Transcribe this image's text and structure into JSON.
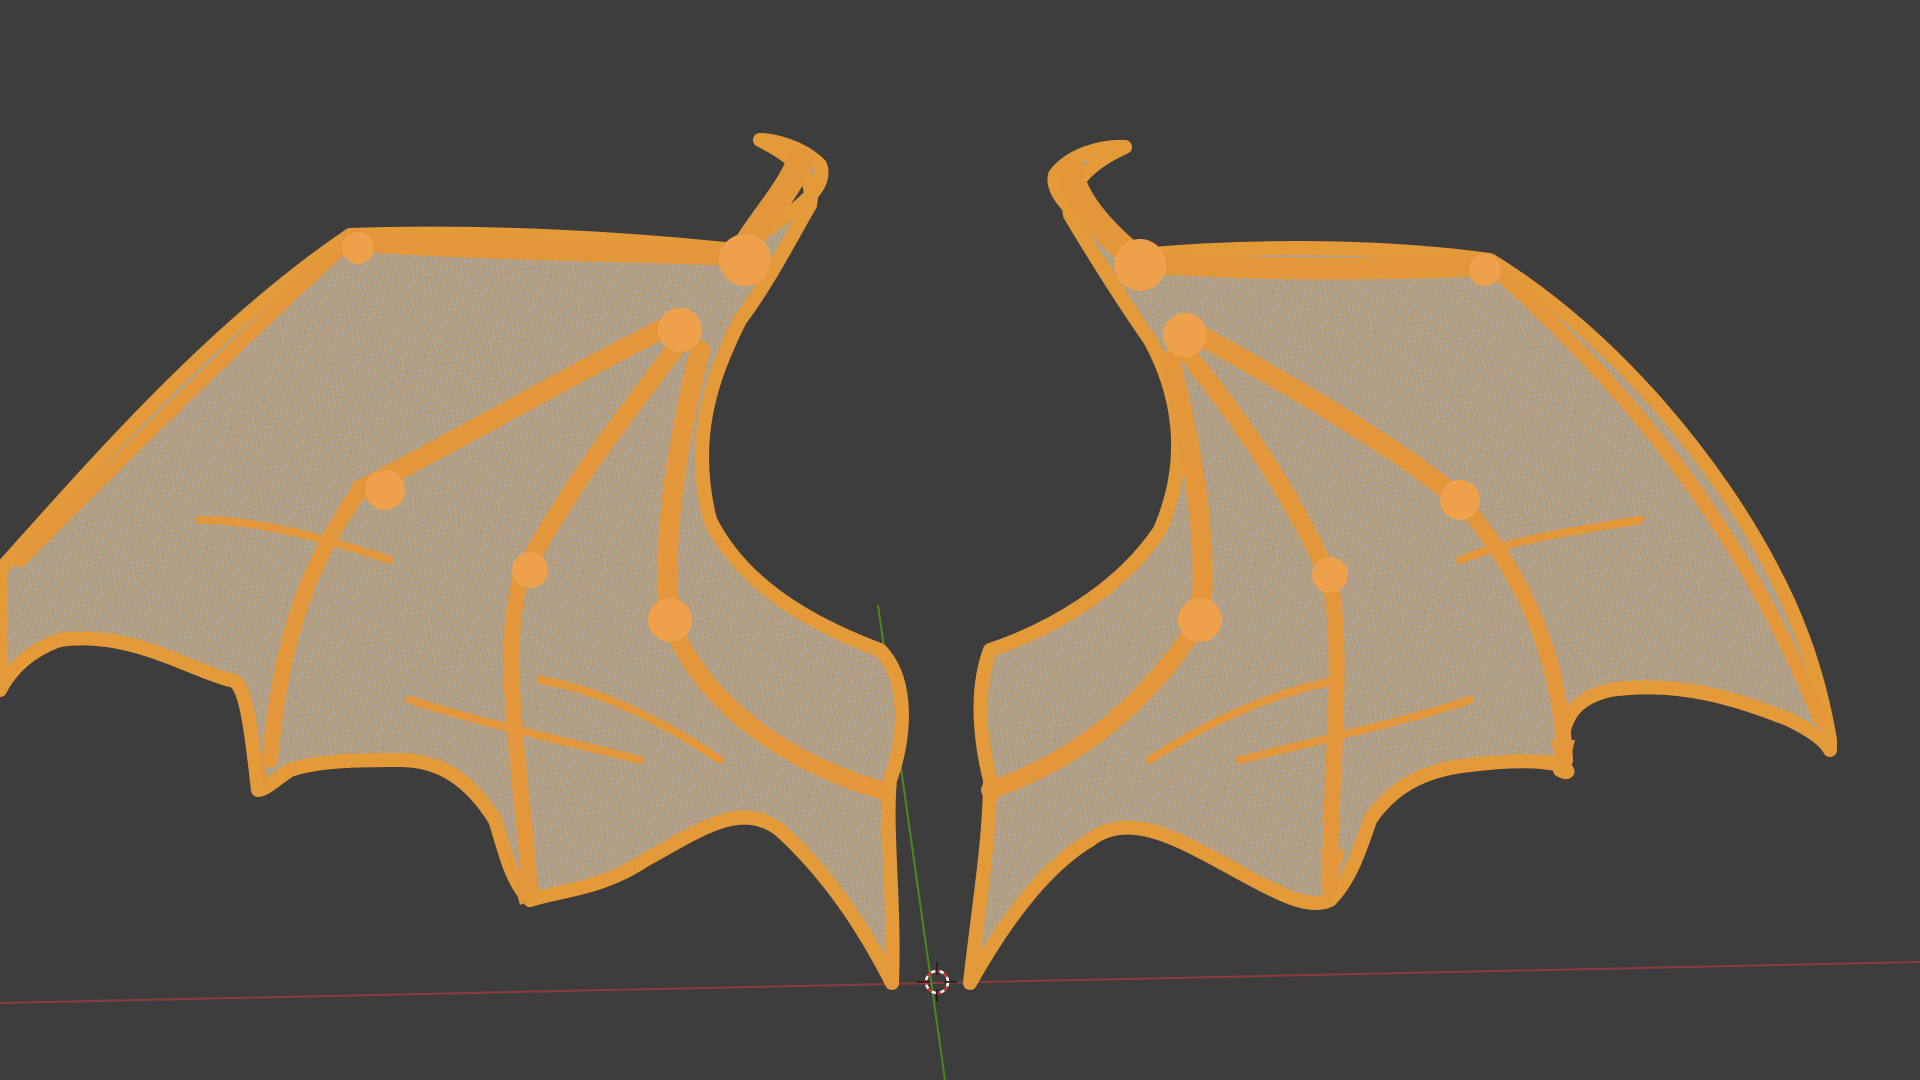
{
  "viewport": {
    "background": "#3d3d3d",
    "selection_color": "#e39a3a",
    "selection_dark": "#b46a14",
    "mesh_color": "#a9a9a3",
    "axes": {
      "x_axis_color": "#9a4040",
      "y_axis_color": "#4f8a25"
    }
  },
  "scene": {
    "selected_object": "wings-mesh",
    "wire_overlay": "on",
    "icons": [
      "3d-cursor-icon"
    ]
  }
}
